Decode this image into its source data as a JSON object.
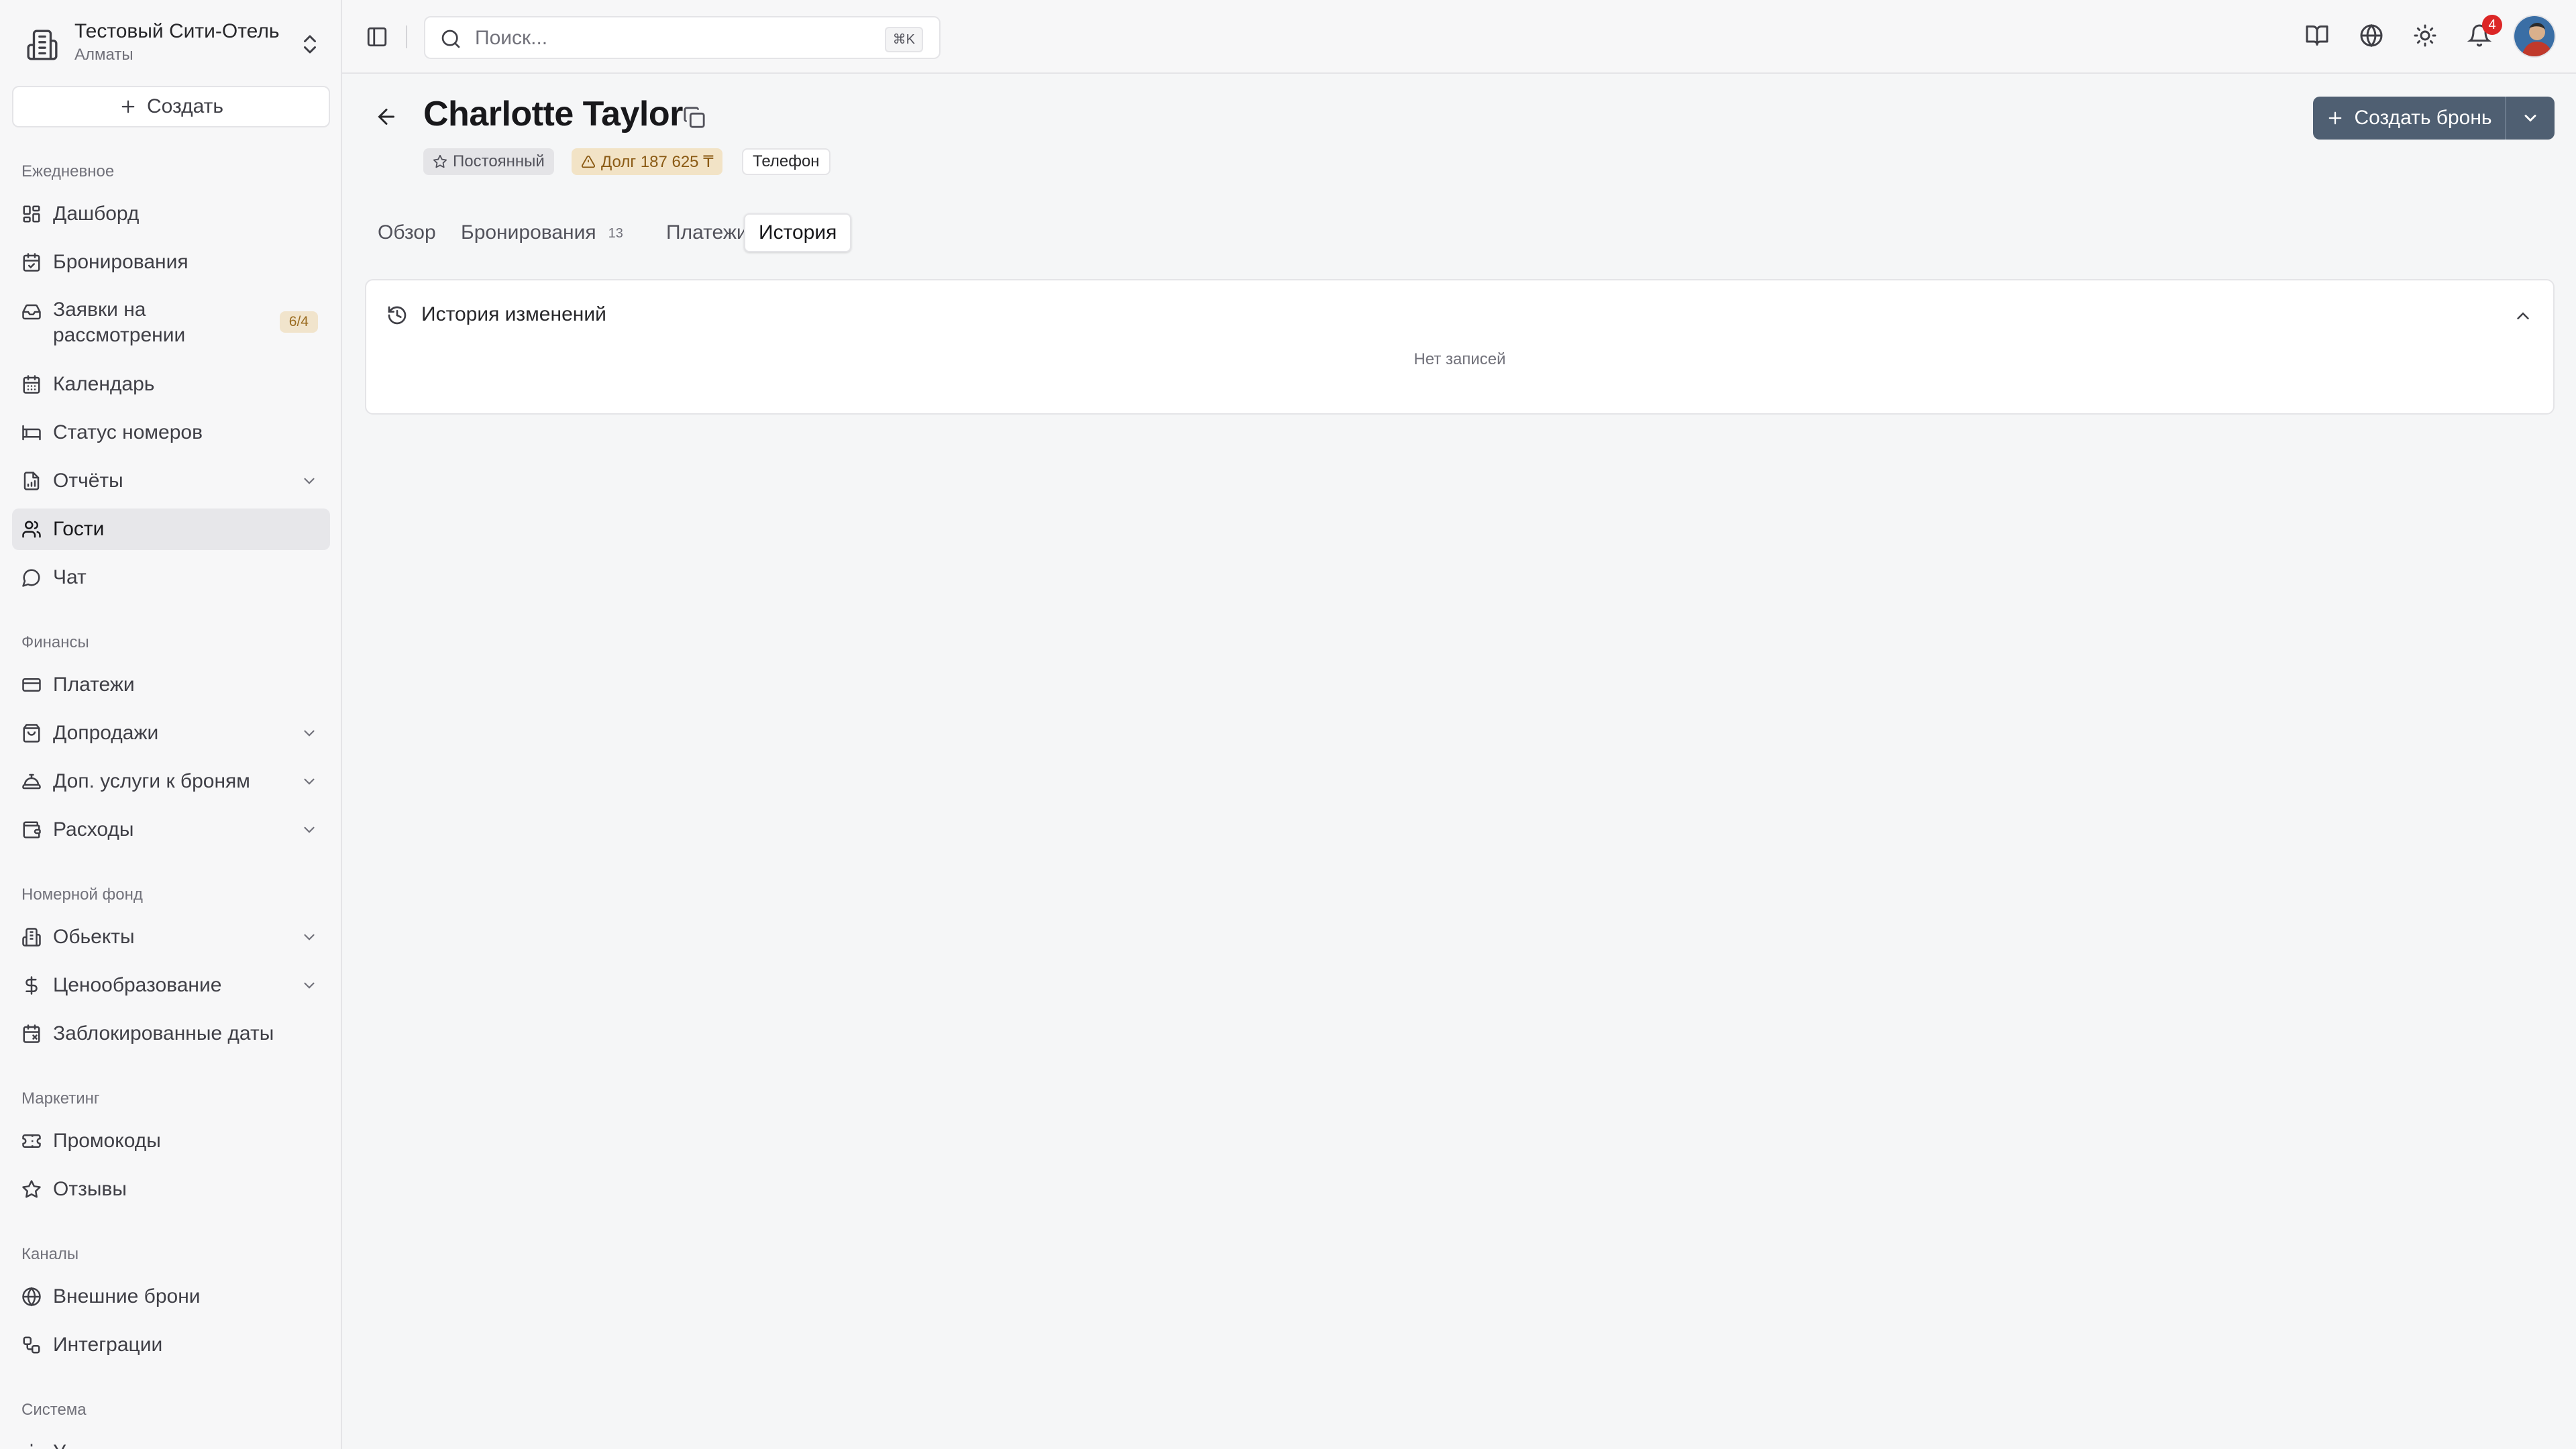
{
  "hotel": {
    "name": "Тестовый Сити-Отель",
    "city": "Алматы"
  },
  "sidebar": {
    "create_label": "Создать",
    "sections": {
      "daily": "Ежедневное",
      "finance": "Финансы",
      "rooms": "Номерной фонд",
      "marketing": "Маркетинг",
      "channels": "Каналы",
      "system": "Система"
    },
    "items": {
      "dashboard": "Дашборд",
      "bookings": "Бронирования",
      "requests": "Заявки на рассмотрении",
      "requests_badge": "6/4",
      "calendar": "Календарь",
      "room_status": "Статус номеров",
      "reports": "Отчёты",
      "guests": "Гости",
      "chat": "Чат",
      "payments": "Платежи",
      "upsells": "Допродажи",
      "extra_services": "Доп. услуги к броням",
      "expenses": "Расходы",
      "properties": "Обьекты",
      "pricing": "Ценообразование",
      "blocked_dates": "Заблокированные даты",
      "promo": "Промокоды",
      "reviews": "Отзывы",
      "external_bookings": "Внешние брони",
      "integrations": "Интеграции",
      "system_next": "У"
    }
  },
  "topbar": {
    "search_placeholder": "Поиск...",
    "search_shortcut": "⌘K",
    "notification_count": "4"
  },
  "guest": {
    "name": "Charlotte Taylor",
    "tags": {
      "status": "Постоянный",
      "debt": "Долг 187 625 ₸",
      "source": "Телефон"
    },
    "create_booking_label": "Создать бронь"
  },
  "tabs": {
    "overview": "Обзор",
    "bookings": "Бронирования",
    "bookings_count": "13",
    "payments": "Платежи",
    "history": "История"
  },
  "history_card": {
    "title": "История изменений",
    "empty_text": "Нет записей"
  },
  "colors": {
    "primary_button": "#4f5f72",
    "notification": "#dc2626",
    "debt_tag_bg": "#f2e3c6"
  }
}
